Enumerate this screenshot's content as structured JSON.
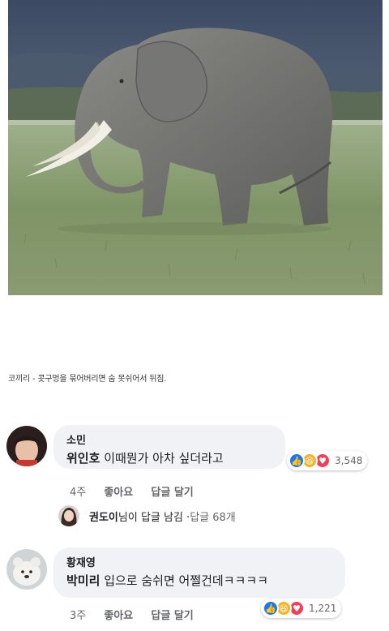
{
  "caption": "코끼리 - 콧구멍을 묶어버리면 숨 못쉬어서 뒤짐.",
  "comments": [
    {
      "author": "소민",
      "mention": "위인호",
      "text": "이때뭔가 아차 싶더라고",
      "reaction_count": "3,548",
      "time": "4주",
      "like": "좋아요",
      "reply": "답글 달기"
    },
    {
      "author": "황재영",
      "mention": "박미리",
      "text": "입으로 숨쉬면 어쩔건데ㅋㅋㅋㅋ",
      "reaction_count": "1,221",
      "time": "3주",
      "like": "좋아요",
      "reply": "답글 달기"
    }
  ],
  "reply_summary": {
    "name": "권도이",
    "suffix": "님이 답글 남김 · ",
    "count": "답글 68개"
  },
  "colors": {
    "like": "#1877f2",
    "haha": "#f7b125",
    "love": "#f33e58",
    "bubble": "#f0f2f5"
  }
}
